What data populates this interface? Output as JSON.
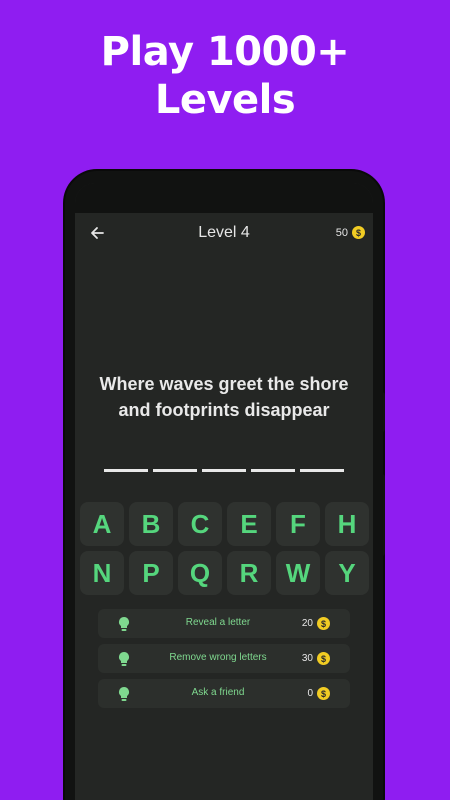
{
  "promo": {
    "line1": "Play 1000+",
    "line2": "Levels"
  },
  "header": {
    "title": "Level 4",
    "coins": "50"
  },
  "clue": {
    "line1": "Where waves greet the shore",
    "line2": "and footprints disappear"
  },
  "answer": {
    "blanks": 5
  },
  "keyboard": {
    "letters": [
      "A",
      "B",
      "C",
      "E",
      "F",
      "H",
      "N",
      "P",
      "Q",
      "R",
      "W",
      "Y"
    ]
  },
  "hints": [
    {
      "label": "Reveal a letter",
      "cost": "20"
    },
    {
      "label": "Remove wrong letters",
      "cost": "30"
    },
    {
      "label": "Ask a friend",
      "cost": "0"
    }
  ],
  "colors": {
    "background": "#8f1df1",
    "accent": "#55d67d",
    "coin": "#f1cc23"
  }
}
